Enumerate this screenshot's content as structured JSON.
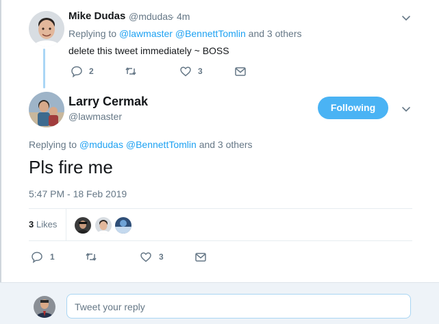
{
  "parent_tweet": {
    "author_name": "Mike Dudas",
    "author_handle": "@mdudas",
    "separator": "·",
    "time_ago": "4m",
    "replying_prefix": "Replying to",
    "replying_user_1": "@lawmaster",
    "replying_user_2": "@BennettTomlin",
    "replying_suffix": "and 3 others",
    "text": "delete this tweet immediately ~ BOSS",
    "reply_count": "2",
    "like_count": "3"
  },
  "main_tweet": {
    "author_name": "Larry Cermak",
    "author_handle": "@lawmaster",
    "follow_button_label": "Following",
    "replying_prefix": "Replying to",
    "replying_user_1": "@mdudas",
    "replying_user_2": "@BennettTomlin",
    "replying_suffix": "and 3 others",
    "text": "Pls fire me",
    "timestamp": "5:47 PM - 18 Feb 2019",
    "likes_count": "3",
    "likes_label": "Likes",
    "reply_count": "1",
    "like_count": "3"
  },
  "composer": {
    "placeholder": "Tweet your reply"
  },
  "colors": {
    "accent": "#1da1f2",
    "follow_button": "#4ab3f4",
    "muted_text": "#657786",
    "thread_line": "#a9d6f5"
  },
  "icons": [
    "chevron-down-icon",
    "reply-icon",
    "retweet-icon",
    "like-icon",
    "message-icon"
  ]
}
